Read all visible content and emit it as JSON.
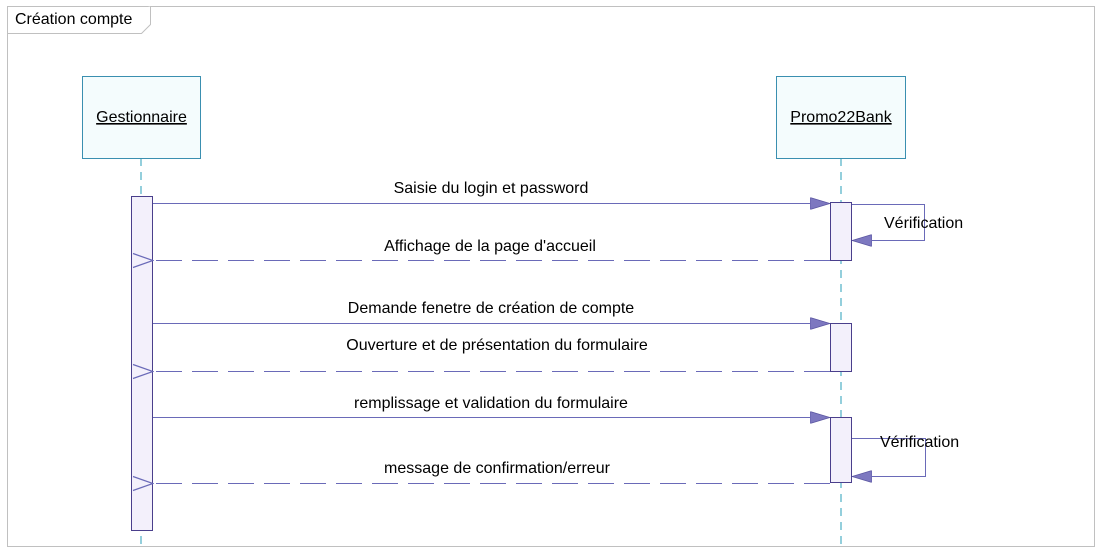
{
  "frame": {
    "title": "Création compte"
  },
  "participants": [
    {
      "id": "gestionnaire",
      "name": "Gestionnaire"
    },
    {
      "id": "promo22bank",
      "name": "Promo22Bank"
    }
  ],
  "messages": [
    {
      "label": "Saisie du login et password",
      "from": "gestionnaire",
      "to": "promo22bank",
      "kind": "sync"
    },
    {
      "label": "Vérification",
      "from": "promo22bank",
      "to": "promo22bank",
      "kind": "self"
    },
    {
      "label": "Affichage de la page d'accueil",
      "from": "promo22bank",
      "to": "gestionnaire",
      "kind": "return"
    },
    {
      "label": "Demande fenetre de création de compte",
      "from": "gestionnaire",
      "to": "promo22bank",
      "kind": "sync"
    },
    {
      "label": "Ouverture et de présentation du formulaire",
      "from": "promo22bank",
      "to": "gestionnaire",
      "kind": "return"
    },
    {
      "label": "remplissage et validation du formulaire",
      "from": "gestionnaire",
      "to": "promo22bank",
      "kind": "sync"
    },
    {
      "label": "Vérification",
      "from": "promo22bank",
      "to": "promo22bank",
      "kind": "self"
    },
    {
      "label": "message de confirmation/erreur",
      "from": "promo22bank",
      "to": "gestionnaire",
      "kind": "return"
    }
  ],
  "colors": {
    "frame_border": "#c0c0c0",
    "participant_fill": "#f4fcfd",
    "participant_border": "#3a8fb0",
    "lifeline": "#2a9fb8",
    "activation_fill": "#f3f0fb",
    "activation_border": "#4a3f8c",
    "message_line": "#6a6ab8",
    "arrow_head": "#7d78c0"
  }
}
